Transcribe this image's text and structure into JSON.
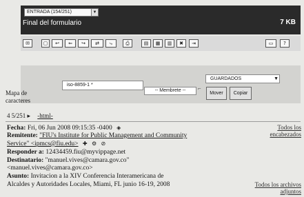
{
  "header": {
    "folder_select": "ENTRADA (154/251)",
    "form_title": "Final del formulario",
    "size": "7 KB"
  },
  "toolbar": {
    "icons": [
      "a",
      "b",
      "c",
      "d",
      "e",
      "f",
      "g",
      "h",
      "i",
      "j",
      "k",
      "l",
      "m",
      "n"
    ]
  },
  "options": {
    "mapa_label": "Mapa de caracteres",
    "charset_value": "iso-8859-1 *",
    "membrete_value": "-- Membrete --",
    "dest_folder": "GUARDADOS",
    "move_button": "Mover",
    "copy_button": "Copiar"
  },
  "pager": {
    "position": "4 5/251 ▸",
    "html_link": "-html-"
  },
  "message": {
    "fecha_label": "Fecha:",
    "fecha_value": "Fri, 06 Jun 2008 09:15:35 -0400",
    "remitente_label": "Remitente:",
    "remitente_line1": "\"FIU's Institute for Public Management and Community",
    "remitente_line2": "Service\" <ipmcs@fiu.edu>",
    "responder_label": "Responder a:",
    "responder_value": "12434459.fiu@myvippage.net",
    "destinatario_label": "Destinatario:",
    "destinatario_value": "\"manuel.vives@camara.gov.co\"",
    "destinatario_line2": "<manuel.vives@camara.gov.co>",
    "asunto_label": "Asunto:",
    "asunto_line1": "Invitacion a la XIV Conferencia Interamericana de",
    "asunto_line2": "Alcaldes y Autoridades Locales, Miami, FL junio 16-19, 2008"
  },
  "side_links": {
    "todos_encabezados_1": "Todos los",
    "todos_encabezados_2": "encabezados",
    "todos_adjuntos_1": "Todos los archivos",
    "todos_adjuntos_2": "adjuntos"
  }
}
